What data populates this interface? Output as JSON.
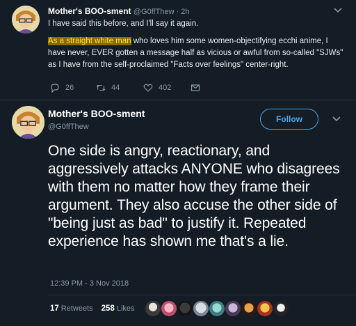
{
  "tweet1": {
    "name": "Mother's BOO-sment",
    "handle_time": "@G0ffThew · 2h",
    "line1": "I have said this before, and I'll say it again.",
    "highlight": "As a straight white man",
    "line2": " who loves him some women-objectifying ecchi anime, I have never, EVER gotten a message half as vicious or awful from so-called \"SJWs\" as I have from the self-proclaimed \"Facts over feelings\" center-right.",
    "replies": "26",
    "retweets": "44",
    "likes": "402"
  },
  "tweet2": {
    "name": "Mother's BOO-sment",
    "handle": "@G0ffThew",
    "follow_label": "Follow",
    "text": "One side is angry, reactionary, and aggressively attacks ANYONE who disagrees with them no matter how they frame their argument. They also accuse the other side of \"being just as bad\" to justify it. Repeated experience has shown me that's a lie.",
    "timestamp": "12:39 PM - 3 Nov 2018",
    "retweets_count": "17",
    "retweets_label": "Retweets",
    "likes_count": "258",
    "likes_label": "Likes"
  },
  "colors": {
    "background": "#141d26",
    "accent": "#4aa5e8",
    "muted": "#8899a6",
    "highlight_bg": "#8a6a00",
    "highlight_fg": "#ffdd40"
  },
  "icons": [
    "reply-icon",
    "retweet-icon",
    "heart-icon",
    "message-icon",
    "chevron-down-icon"
  ]
}
